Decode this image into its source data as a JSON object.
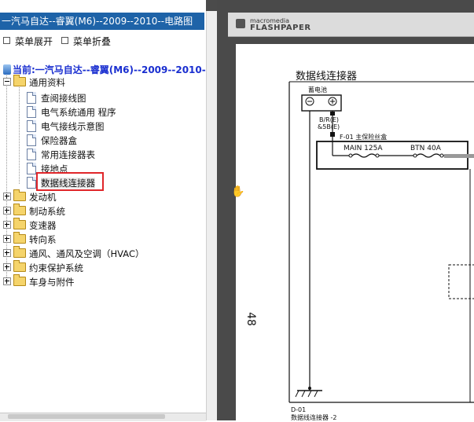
{
  "window": {
    "title": "一汽马自达--睿翼(M6)--2009--2010--电路图"
  },
  "menu": {
    "expand_label": "菜单展开",
    "collapse_label": "菜单折叠"
  },
  "current": {
    "label": "当前:一汽马自达--睿翼(M6)--2009--2010--电路"
  },
  "tree": {
    "root": {
      "label": "通用资料"
    },
    "children": [
      {
        "label": "查阅接线图"
      },
      {
        "label": "电气系统通用 程序"
      },
      {
        "label": "电气接线示意图"
      },
      {
        "label": "保险器盒"
      },
      {
        "label": "常用连接器表"
      },
      {
        "label": "接地点"
      },
      {
        "label": "数据线连接器"
      }
    ],
    "folders": [
      {
        "label": "发动机"
      },
      {
        "label": "制动系统"
      },
      {
        "label": "变速器"
      },
      {
        "label": "转向系"
      },
      {
        "label": "通风、通风及空调（HVAC）"
      },
      {
        "label": "约束保护系统"
      },
      {
        "label": "车身与附件"
      }
    ]
  },
  "viewer": {
    "brand_small": "macromedia",
    "brand_large": "FLASHPAPER",
    "page_number": "48",
    "doc_title": "数据线连接器",
    "battery_label": "蓄电池",
    "wire_label_1": "B/R(E)",
    "wire_label_2": "&5B(E)",
    "fuse_box_label": "F-01 主保险丝盒",
    "fuse_1": "MAIN 125A",
    "fuse_2": "BTN 40A",
    "footer_code": "D-01",
    "footer_text": "数据线连接器 -2"
  },
  "colors": {
    "title_bar": "#1e63a8",
    "highlight_box": "#e0262a",
    "current_text": "#1a2fd0",
    "viewer_bg": "#4a4a4a"
  }
}
